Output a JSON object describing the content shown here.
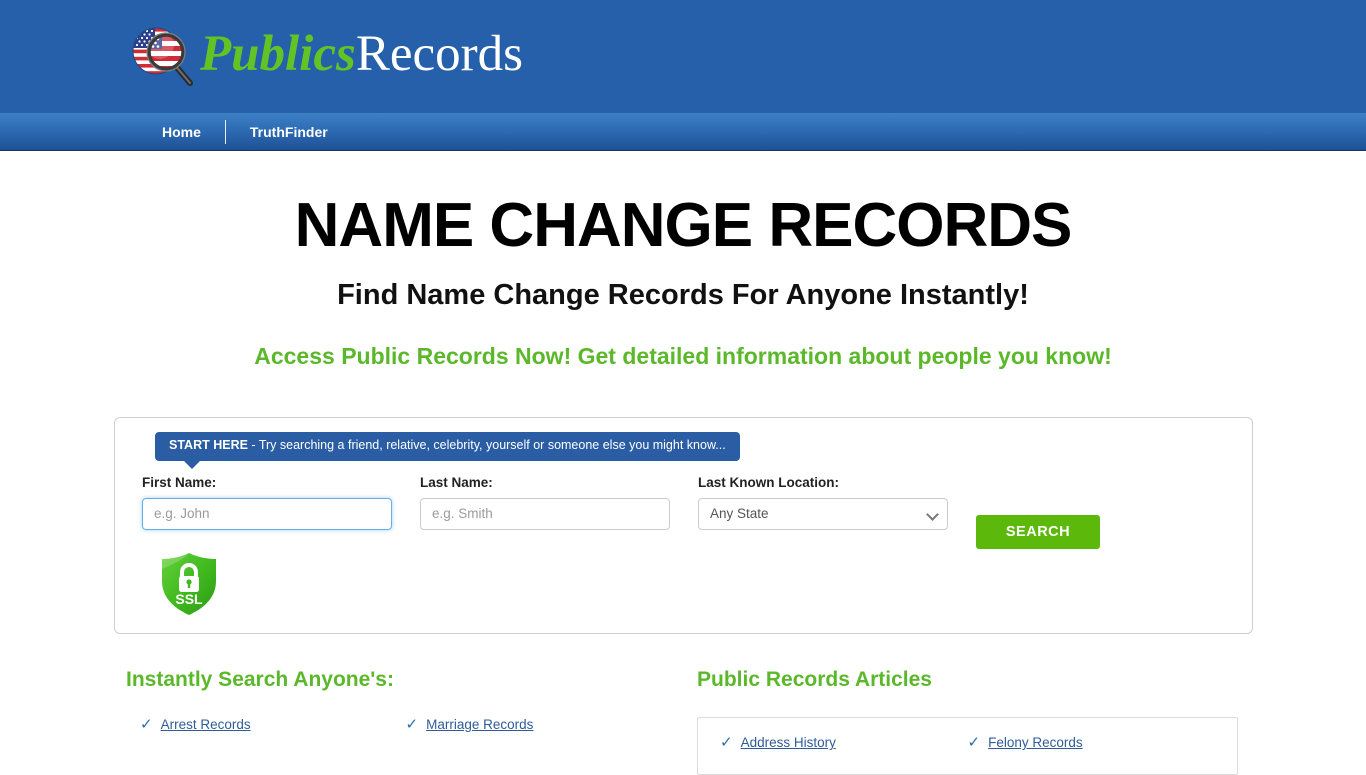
{
  "header": {
    "logo_icon": "usa-flag-magnifier-icon",
    "logo_part_a": "Publics",
    "logo_part_b": "Records",
    "brand_green": "#62C424",
    "header_blue": "#2660AB"
  },
  "nav": {
    "items": [
      {
        "label": "Home"
      },
      {
        "label": "TruthFinder"
      }
    ]
  },
  "main": {
    "h1": "NAME CHANGE RECORDS",
    "h2": "Find Name Change Records For Anyone Instantly!",
    "h3": "Access Public Records Now! Get detailed information about people you know!",
    "h3_color": "#5CB82B"
  },
  "search_form": {
    "tooltip_bold": "START HERE",
    "tooltip_rest": " - Try searching a friend, relative, celebrity, yourself or someone else you might know...",
    "first_name": {
      "label": "First Name:",
      "placeholder": "e.g. John",
      "value": "",
      "focused": true
    },
    "last_name": {
      "label": "Last Name:",
      "placeholder": "e.g. Smith",
      "value": ""
    },
    "location": {
      "label": "Last Known Location:",
      "selected": "Any State",
      "options": [
        "Any State"
      ]
    },
    "search_button": "SEARCH",
    "search_button_color": "#5CB80A",
    "ssl_badge_label": "SSL",
    "ssl_badge_icon": "green-shield-padlock-icon"
  },
  "bottom": {
    "left": {
      "heading": "Instantly Search Anyone's:",
      "links": [
        {
          "label": "Arrest Records",
          "icon": "checkmark-icon"
        },
        {
          "label": "Marriage Records",
          "icon": "checkmark-icon"
        }
      ]
    },
    "right": {
      "heading": "Public Records Articles",
      "links": [
        {
          "label": "Address History",
          "icon": "checkmark-icon"
        },
        {
          "label": "Felony Records",
          "icon": "checkmark-icon"
        }
      ]
    }
  }
}
